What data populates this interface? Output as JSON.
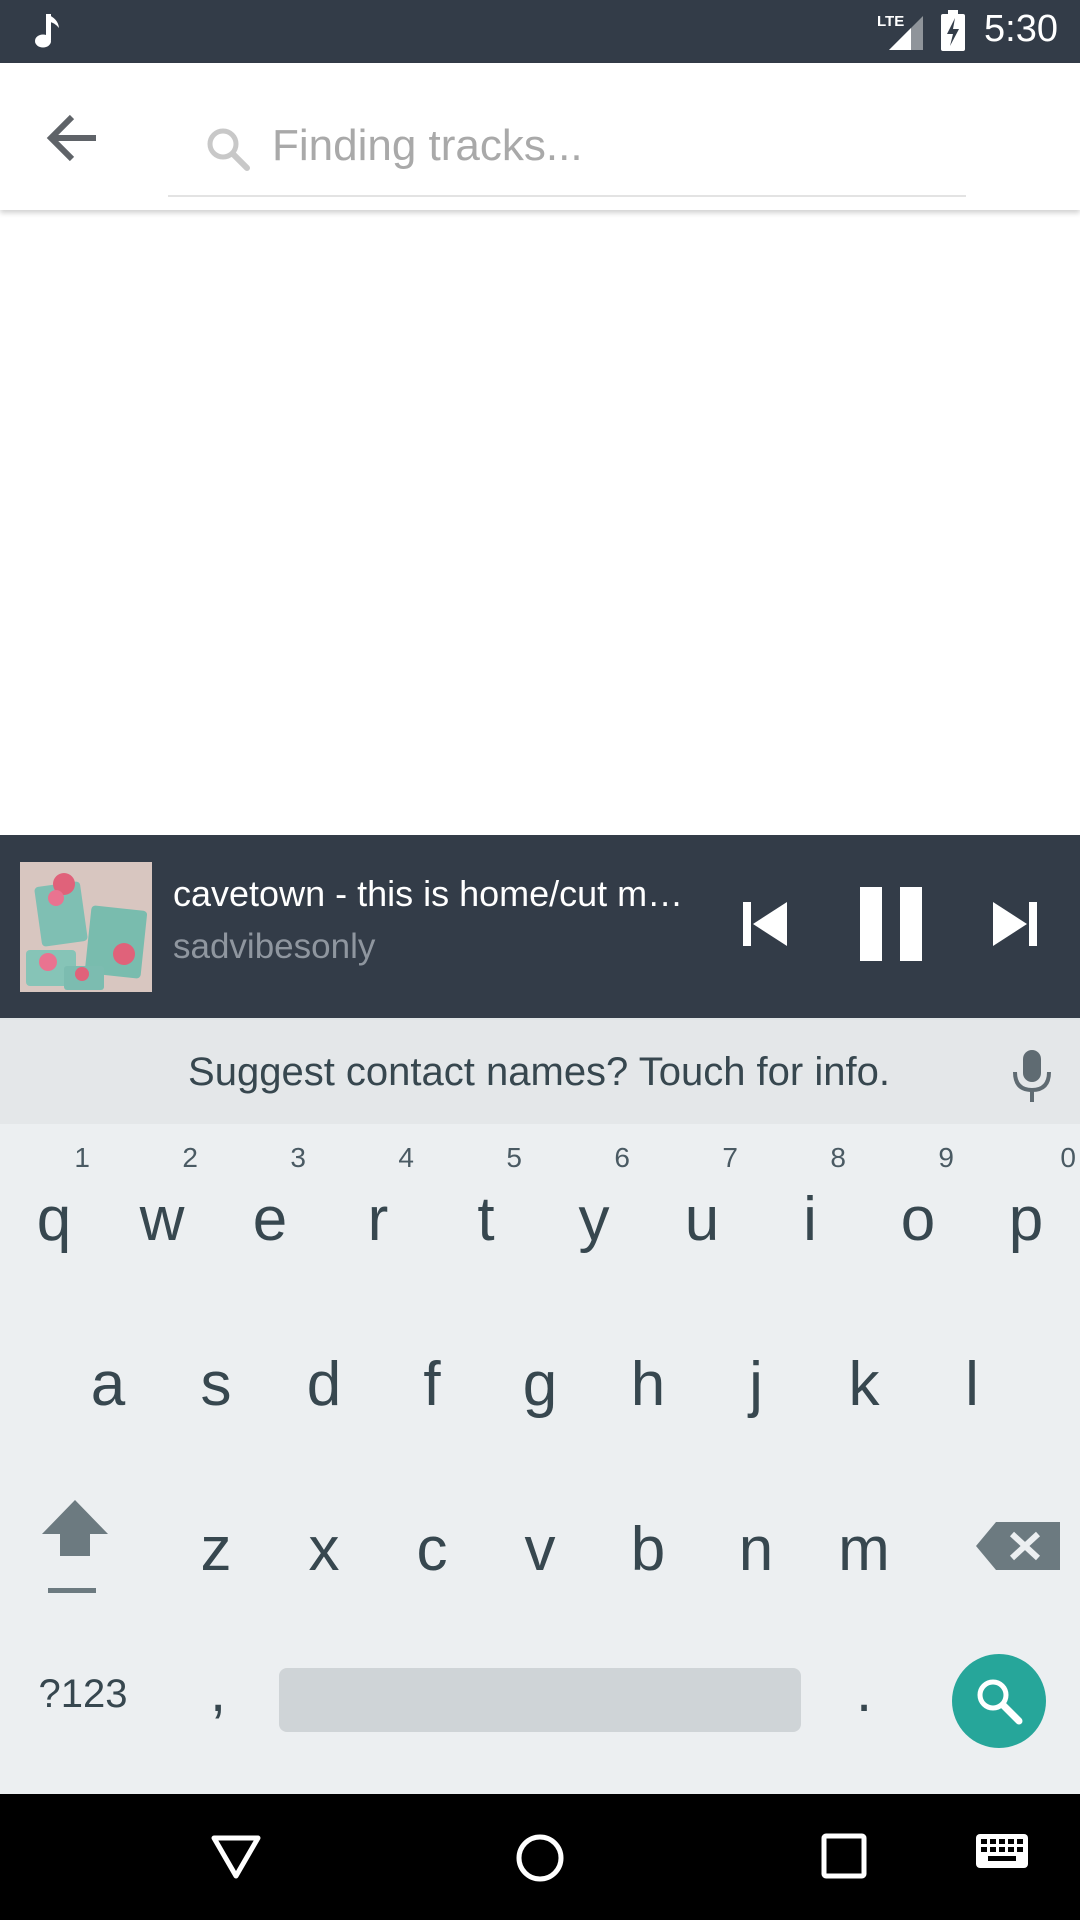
{
  "status_bar": {
    "time": "5:30",
    "network": "LTE",
    "icons": [
      "music-note-icon",
      "signal-icon",
      "battery-charging-icon"
    ]
  },
  "search": {
    "placeholder": "Finding tracks...",
    "value": "",
    "icons": [
      "back-arrow-icon",
      "search-icon"
    ]
  },
  "now_playing": {
    "title": "cavetown - this is home/cut my hair",
    "artist": "sadvibesonly",
    "controls": [
      "previous-icon",
      "pause-icon",
      "next-icon"
    ]
  },
  "keyboard": {
    "suggestion": "Suggest contact names? Touch for info.",
    "row1": [
      {
        "key": "q",
        "hint": "1"
      },
      {
        "key": "w",
        "hint": "2"
      },
      {
        "key": "e",
        "hint": "3"
      },
      {
        "key": "r",
        "hint": "4"
      },
      {
        "key": "t",
        "hint": "5"
      },
      {
        "key": "y",
        "hint": "6"
      },
      {
        "key": "u",
        "hint": "7"
      },
      {
        "key": "i",
        "hint": "8"
      },
      {
        "key": "o",
        "hint": "9"
      },
      {
        "key": "p",
        "hint": "0"
      }
    ],
    "row2": [
      "a",
      "s",
      "d",
      "f",
      "g",
      "h",
      "j",
      "k",
      "l"
    ],
    "row3": [
      "z",
      "x",
      "c",
      "v",
      "b",
      "n",
      "m"
    ],
    "symbols_label": "?123",
    "comma_label": ",",
    "period_label": ".",
    "action_color": "#26a69a"
  },
  "colors": {
    "bar_dark": "#333c48",
    "keyboard_bg": "#eceff1",
    "key_text": "#37474f"
  }
}
